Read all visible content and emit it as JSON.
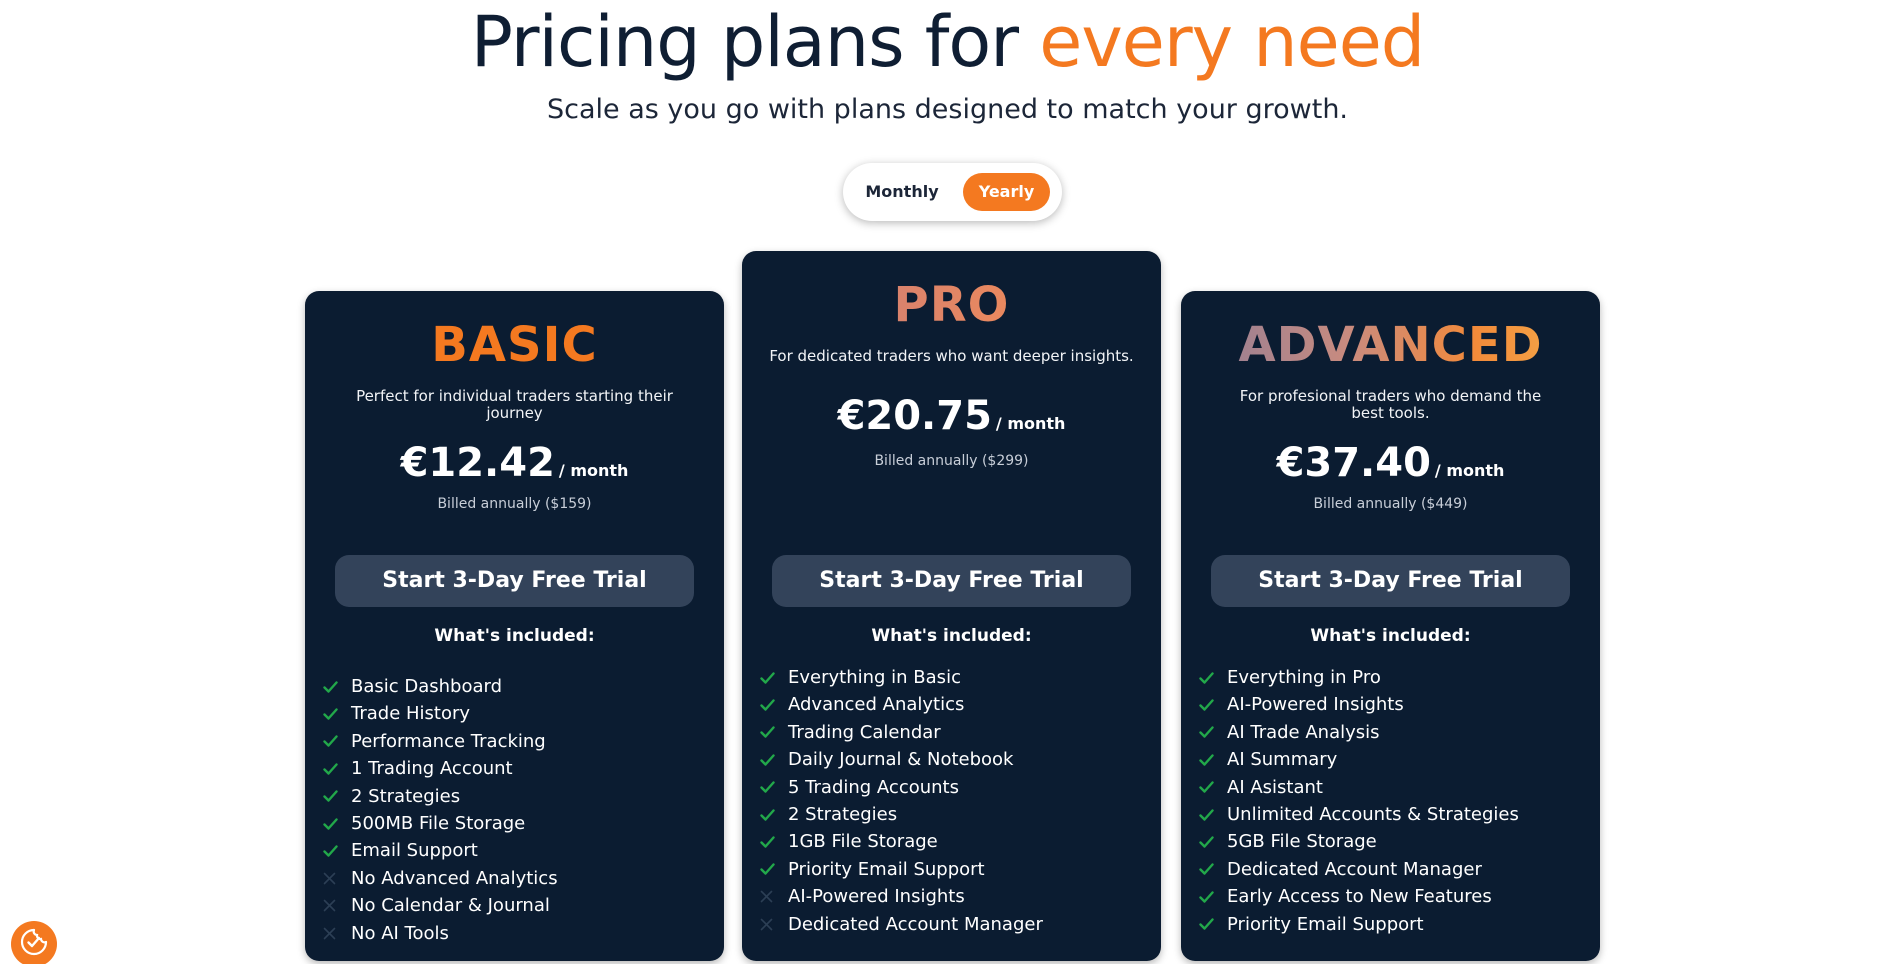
{
  "header": {
    "title_main": "Pricing plans for ",
    "title_accent": "every need",
    "subtitle": "Scale as you go with plans designed to match your growth."
  },
  "billing_toggle": {
    "options": [
      "Monthly",
      "Yearly"
    ],
    "selected": "Yearly"
  },
  "colors": {
    "accent": "#f47920",
    "card_bg": "#0b1c31",
    "button_bg": "#33435a",
    "check": "#22a84a",
    "cross": "#2c3f55"
  },
  "plans": [
    {
      "name": "BASIC",
      "description": "Perfect for individual traders starting their journey",
      "price": "€12.42",
      "period": "/ month",
      "billed": "Billed annually ($159)",
      "cta": "Start 3-Day Free Trial",
      "included_label": "What's included:",
      "features": [
        {
          "text": "Basic Dashboard",
          "included": true
        },
        {
          "text": "Trade History",
          "included": true
        },
        {
          "text": "Performance Tracking",
          "included": true
        },
        {
          "text": "1 Trading Account",
          "included": true
        },
        {
          "text": "2 Strategies",
          "included": true
        },
        {
          "text": "500MB File Storage",
          "included": true
        },
        {
          "text": "Email Support",
          "included": true
        },
        {
          "text": "No Advanced Analytics",
          "included": false
        },
        {
          "text": "No Calendar & Journal",
          "included": false
        },
        {
          "text": "No AI Tools",
          "included": false
        }
      ]
    },
    {
      "name": "PRO",
      "description": "For dedicated traders who want deeper insights.",
      "price": "€20.75",
      "period": "/ month",
      "billed": "Billed annually ($299)",
      "cta": "Start 3-Day Free Trial",
      "included_label": "What's included:",
      "features": [
        {
          "text": "Everything in Basic",
          "included": true
        },
        {
          "text": "Advanced Analytics",
          "included": true
        },
        {
          "text": "Trading Calendar",
          "included": true
        },
        {
          "text": "Daily Journal & Notebook",
          "included": true
        },
        {
          "text": "5 Trading Accounts",
          "included": true
        },
        {
          "text": "2 Strategies",
          "included": true
        },
        {
          "text": "1GB File Storage",
          "included": true
        },
        {
          "text": "Priority Email Support",
          "included": true
        },
        {
          "text": "AI-Powered Insights",
          "included": false
        },
        {
          "text": "Dedicated Account Manager",
          "included": false
        }
      ]
    },
    {
      "name": "ADVANCED",
      "description": "For profesional traders who demand the best tools.",
      "price": "€37.40",
      "period": "/ month",
      "billed": "Billed annually ($449)",
      "cta": "Start 3-Day Free Trial",
      "included_label": "What's included:",
      "features": [
        {
          "text": "Everything in Pro",
          "included": true
        },
        {
          "text": "AI-Powered Insights",
          "included": true
        },
        {
          "text": "AI Trade Analysis",
          "included": true
        },
        {
          "text": "AI Summary",
          "included": true
        },
        {
          "text": "AI Asistant",
          "included": true
        },
        {
          "text": "Unlimited Accounts & Strategies",
          "included": true
        },
        {
          "text": "5GB File Storage",
          "included": true
        },
        {
          "text": "Dedicated Account Manager",
          "included": true
        },
        {
          "text": "Early Access to New Features",
          "included": true
        },
        {
          "text": "Priority Email Support",
          "included": true
        }
      ]
    }
  ],
  "consent_button": {
    "icon": "cookie-consent-icon"
  }
}
